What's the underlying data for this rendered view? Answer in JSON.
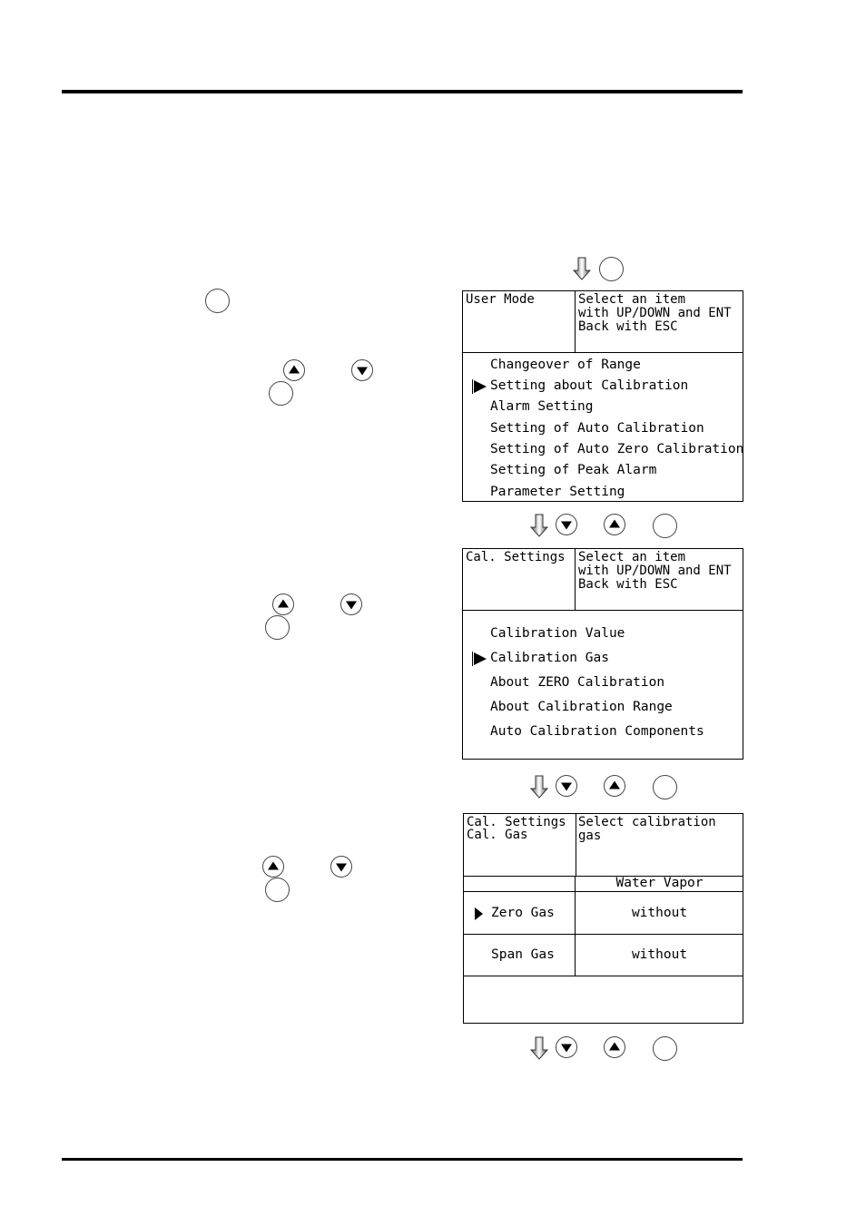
{
  "page": {
    "rules": [
      "top-rule",
      "bottom-rule"
    ]
  },
  "screens": {
    "user_mode": {
      "title": "User Mode",
      "instructions": "Select an item\nwith UP/DOWN and ENT\nBack with ESC",
      "items": [
        "Changeover of Range",
        "Setting about Calibration",
        "Alarm Setting",
        "Setting of Auto Calibration",
        "Setting of Auto Zero Calibration",
        "Setting of Peak Alarm",
        "Parameter Setting"
      ],
      "selected_index": 1
    },
    "cal_settings": {
      "title": "Cal. Settings",
      "instructions": "Select an item\nwith UP/DOWN and ENT\nBack with ESC",
      "items": [
        "Calibration Value",
        "Calibration Gas",
        "About ZERO Calibration",
        "About Calibration Range",
        "Auto Calibration Components"
      ],
      "selected_index": 1
    },
    "cal_gas": {
      "title": "Cal. Settings\nCal. Gas",
      "instructions": "Select calibration gas",
      "column_header": "Water Vapor",
      "rows": [
        {
          "label": "Zero Gas",
          "value": "without",
          "selected": true
        },
        {
          "label": "Span Gas",
          "value": "without",
          "selected": false
        }
      ]
    }
  },
  "icons": {
    "flow_arrow": "down-arrow-icon",
    "ent_key": "ent-key-icon",
    "up_key": "up-key-icon",
    "down_key": "down-key-icon"
  }
}
